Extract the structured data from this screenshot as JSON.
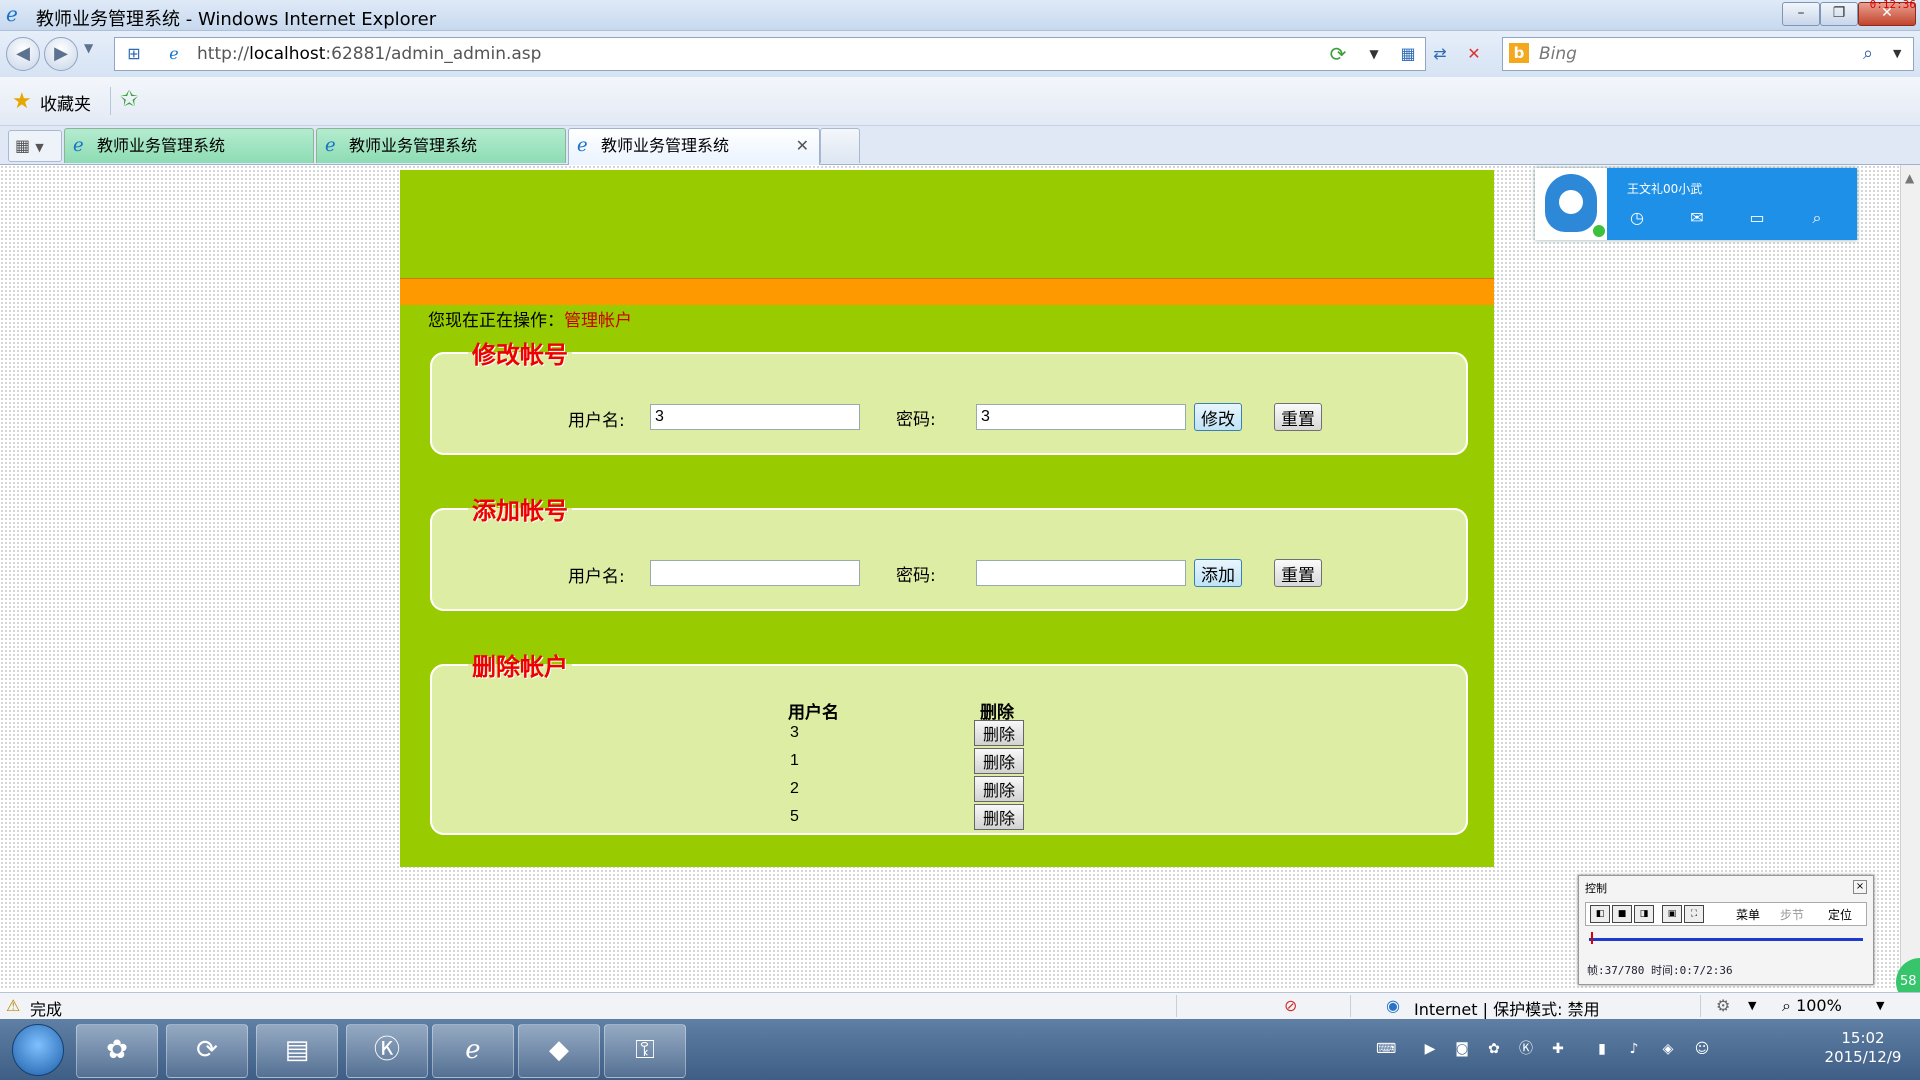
{
  "window": {
    "title": "教师业务管理系统 - Windows Internet Explorer",
    "recording_time": "0:12:36",
    "minimize_label": "–",
    "maximize_label": "❐",
    "close_label": "✕"
  },
  "nav": {
    "url_prefix": "http://",
    "url_host": "localhost",
    "url_rest": ":62881/admin_admin.asp",
    "search_placeholder": "Bing",
    "search_logo": "b"
  },
  "favorites": {
    "label": "收藏夹"
  },
  "tabs": [
    {
      "label": "教师业务管理系统",
      "active": false
    },
    {
      "label": "教师业务管理系统",
      "active": false
    },
    {
      "label": "教师业务管理系统",
      "active": true
    }
  ],
  "page": {
    "crumb_prefix": "您现在正在操作：",
    "crumb_link": "管理帐户",
    "modify": {
      "legend": "修改帐号",
      "username_label": "用户名:",
      "username_value": "3",
      "password_label": "密码:",
      "password_value": "3",
      "submit_label": "修改",
      "reset_label": "重置"
    },
    "add": {
      "legend": "添加帐号",
      "username_label": "用户名:",
      "username_value": "",
      "password_label": "密码:",
      "password_value": "",
      "submit_label": "添加",
      "reset_label": "重置"
    },
    "delete": {
      "legend": "删除帐户",
      "col_username": "用户名",
      "col_delete": "删除",
      "delete_label": "删除",
      "rows": [
        "3",
        "1",
        "2",
        "5"
      ]
    }
  },
  "qq": {
    "nickname": "王文礼00小武"
  },
  "player": {
    "title": "控制",
    "menu_label": "菜单",
    "step_label": "步节",
    "locate_label": "定位",
    "info": "帧:37/780 时间:0:7/2:36"
  },
  "greenball_label": "58",
  "status": {
    "text": "完成",
    "zone": "Internet | 保护模式: 禁用",
    "zoom": "100%"
  },
  "clock": {
    "time": "15:02",
    "date": "2015/12/9"
  },
  "colors": {
    "site_green": "#99cc00",
    "panel_bg": "#deeda4",
    "orange_bar": "#ff9900",
    "legend_red": "#ee0000"
  }
}
